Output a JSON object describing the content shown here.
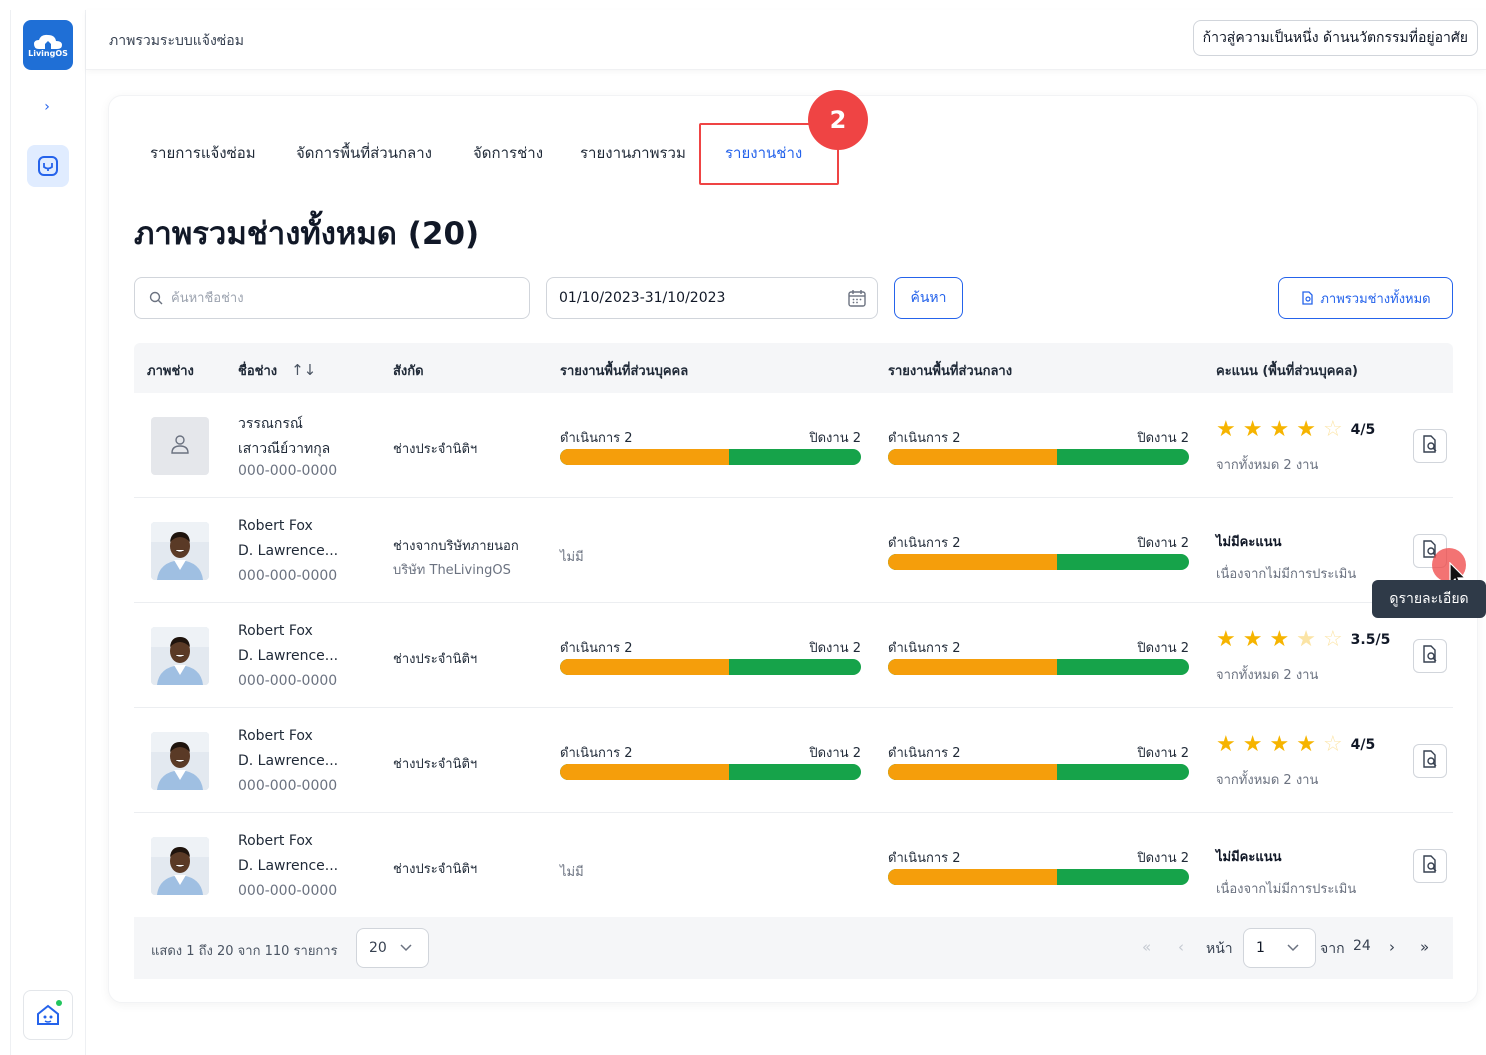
{
  "header": {
    "breadcrumb": "ภาพรวมระบบแจ้งซ่อม",
    "tagline": "ก้าวสู่ความเป็นหนึ่ง ด้านนวัตกรรมที่อยู่อาศัย",
    "logo_text": "LivingOS"
  },
  "tabs": [
    {
      "label": "รายการแจ้งซ่อม",
      "active": false
    },
    {
      "label": "จัดการพื้นที่ส่วนกลาง",
      "active": false
    },
    {
      "label": "จัดการช่าง",
      "active": false
    },
    {
      "label": "รายงานภาพรวม",
      "active": false
    },
    {
      "label": "รายงานช่าง",
      "active": true
    }
  ],
  "step_badge": "2",
  "page_title": "ภาพรวมช่างทั้งหมด (20)",
  "filters": {
    "search_placeholder": "ค้นหาชื่อช่าง",
    "date_range": "01/10/2023-31/10/2023",
    "search_button": "ค้นหา",
    "overview_button": "ภาพรวมช่างทั้งหมด"
  },
  "table": {
    "columns": [
      "ภาพช่าง",
      "ชื่อช่าง",
      "สังกัด",
      "รายงานพื้นที่ส่วนบุคคล",
      "รายงานพื้นที่ส่วนกลาง",
      "คะแนน (พื้นที่ส่วนบุคคล)"
    ],
    "sort_icon": "↑↓",
    "rows": [
      {
        "avatar": "placeholder",
        "name1": "วรรณกรณ์",
        "name2": "เสาวณีย์วาทกุล",
        "phone": "000-000-0000",
        "affiliation": "ช่างประจำนิติฯ",
        "affiliation_company": "",
        "personal": {
          "has": true,
          "in_progress": "ดำเนินการ 2",
          "closed": "ปิดงาน 2",
          "progress_fraction": 0.56
        },
        "common": {
          "has": true,
          "in_progress": "ดำเนินการ 2",
          "closed": "ปิดงาน 2",
          "progress_fraction": 0.56
        },
        "rating": {
          "has": true,
          "stars": 4,
          "score": "4/5",
          "sub": "จากทั้งหมด 2 งาน"
        }
      },
      {
        "avatar": "photo",
        "name1": "Robert Fox",
        "name2": "D. Lawrence...",
        "phone": "000-000-0000",
        "affiliation": "ช่างจากบริษัทภายนอก",
        "affiliation_company": "บริษัท TheLivingOS",
        "personal": {
          "has": false,
          "none_text": "ไม่มี"
        },
        "common": {
          "has": true,
          "in_progress": "ดำเนินการ 2",
          "closed": "ปิดงาน 2",
          "progress_fraction": 0.56
        },
        "rating": {
          "has": false,
          "title": "ไม่มีคะแนน",
          "sub": "เนื่องจากไม่มีการประเมิน"
        }
      },
      {
        "avatar": "photo",
        "name1": "Robert Fox",
        "name2": "D. Lawrence...",
        "phone": "000-000-0000",
        "affiliation": "ช่างประจำนิติฯ",
        "affiliation_company": "",
        "personal": {
          "has": true,
          "in_progress": "ดำเนินการ 2",
          "closed": "ปิดงาน 2",
          "progress_fraction": 0.56
        },
        "common": {
          "has": true,
          "in_progress": "ดำเนินการ 2",
          "closed": "ปิดงาน 2",
          "progress_fraction": 0.56
        },
        "rating": {
          "has": true,
          "stars": 3.5,
          "score": "3.5/5",
          "sub": "จากทั้งหมด 2 งาน"
        }
      },
      {
        "avatar": "photo",
        "name1": "Robert Fox",
        "name2": "D. Lawrence...",
        "phone": "000-000-0000",
        "affiliation": "ช่างประจำนิติฯ",
        "affiliation_company": "",
        "personal": {
          "has": true,
          "in_progress": "ดำเนินการ 2",
          "closed": "ปิดงาน 2",
          "progress_fraction": 0.56
        },
        "common": {
          "has": true,
          "in_progress": "ดำเนินการ 2",
          "closed": "ปิดงาน 2",
          "progress_fraction": 0.56
        },
        "rating": {
          "has": true,
          "stars": 4,
          "score": "4/5",
          "sub": "จากทั้งหมด 2 งาน"
        }
      },
      {
        "avatar": "photo",
        "name1": "Robert Fox",
        "name2": "D. Lawrence...",
        "phone": "000-000-0000",
        "affiliation": "ช่างประจำนิติฯ",
        "affiliation_company": "",
        "personal": {
          "has": false,
          "none_text": "ไม่มี"
        },
        "common": {
          "has": true,
          "in_progress": "ดำเนินการ 2",
          "closed": "ปิดงาน 2",
          "progress_fraction": 0.56
        },
        "rating": {
          "has": false,
          "title": "ไม่มีคะแนน",
          "sub": "เนื่องจากไม่มีการประเมิน"
        }
      }
    ]
  },
  "tooltip": "ดูรายละเอียด",
  "pagination": {
    "summary": "แสดง 1 ถึง 20 จาก 110 รายการ",
    "page_size": "20",
    "page_label": "หน้า",
    "current_page": "1",
    "of_label": "จาก",
    "total_pages": "24",
    "first": "«",
    "prev": "‹",
    "next": "›",
    "last": "»"
  },
  "colors": {
    "accent": "#2563eb",
    "in_progress": "#f59e0b",
    "closed": "#16a34a",
    "star": "#f6b400",
    "highlight": "#ef4444"
  }
}
